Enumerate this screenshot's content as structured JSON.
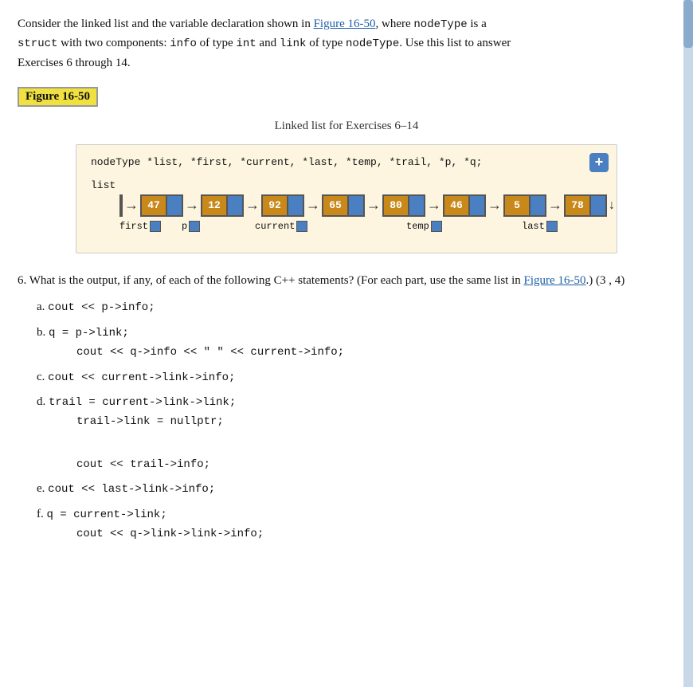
{
  "intro": {
    "text1": "Consider the linked list and the variable declaration shown in ",
    "figure_link": "Figure 16-50",
    "text2": ", where ",
    "code1": "nodeType",
    "text3": " is a",
    "line2_1": "struct",
    "text4": " with two components: ",
    "code2": "info",
    "text5": " of type ",
    "code3": "int",
    "text6": " and ",
    "code4": "link",
    "text7": " of type ",
    "code5": "nodeType",
    "text8": ". Use this list to answer",
    "text9": "Exercises 6 through 14."
  },
  "figure": {
    "label": "Figure 16-50",
    "title": "Linked list for Exercises 6–14",
    "decl": "nodeType *list, *first, *current, *last, *temp, *trail, *p, *q;",
    "list_label": "list",
    "nodes": [
      {
        "info": "47",
        "id": "n47"
      },
      {
        "info": "12",
        "id": "n12"
      },
      {
        "info": "92",
        "id": "n92"
      },
      {
        "info": "65",
        "id": "n65"
      },
      {
        "info": "80",
        "id": "n80"
      },
      {
        "info": "46",
        "id": "n46"
      },
      {
        "info": "5",
        "id": "n5"
      },
      {
        "info": "78",
        "id": "n78"
      }
    ],
    "pointers": [
      {
        "label": "first",
        "node_index": 0
      },
      {
        "label": "p",
        "node_index": 1
      },
      {
        "label": "current",
        "node_index": 2
      },
      {
        "label": "temp",
        "node_index": 4
      },
      {
        "label": "last",
        "node_index": 6
      }
    ],
    "plus_label": "+"
  },
  "question6": {
    "number": "6.",
    "text": "What is the output, if any, of each of the following C++ statements? (For each part, use the same list in ",
    "figure_link": "Figure 16-50",
    "text2": ".) (3 , 4)",
    "parts": [
      {
        "label": "a.",
        "lines": [
          "cout << p->info;"
        ]
      },
      {
        "label": "b.",
        "lines": [
          "q = p->link;",
          "cout << q->info << \" \" << current->info;"
        ]
      },
      {
        "label": "c.",
        "lines": [
          "cout << current->link->info;"
        ]
      },
      {
        "label": "d.",
        "lines": [
          "trail = current->link->link;",
          "trail->link = nullptr;",
          "cout << trail->info;"
        ]
      },
      {
        "label": "e.",
        "lines": [
          "cout << last->link->info;"
        ]
      },
      {
        "label": "f.",
        "lines": [
          "q = current->link;",
          "cout << q->link->link->info;"
        ]
      }
    ]
  }
}
